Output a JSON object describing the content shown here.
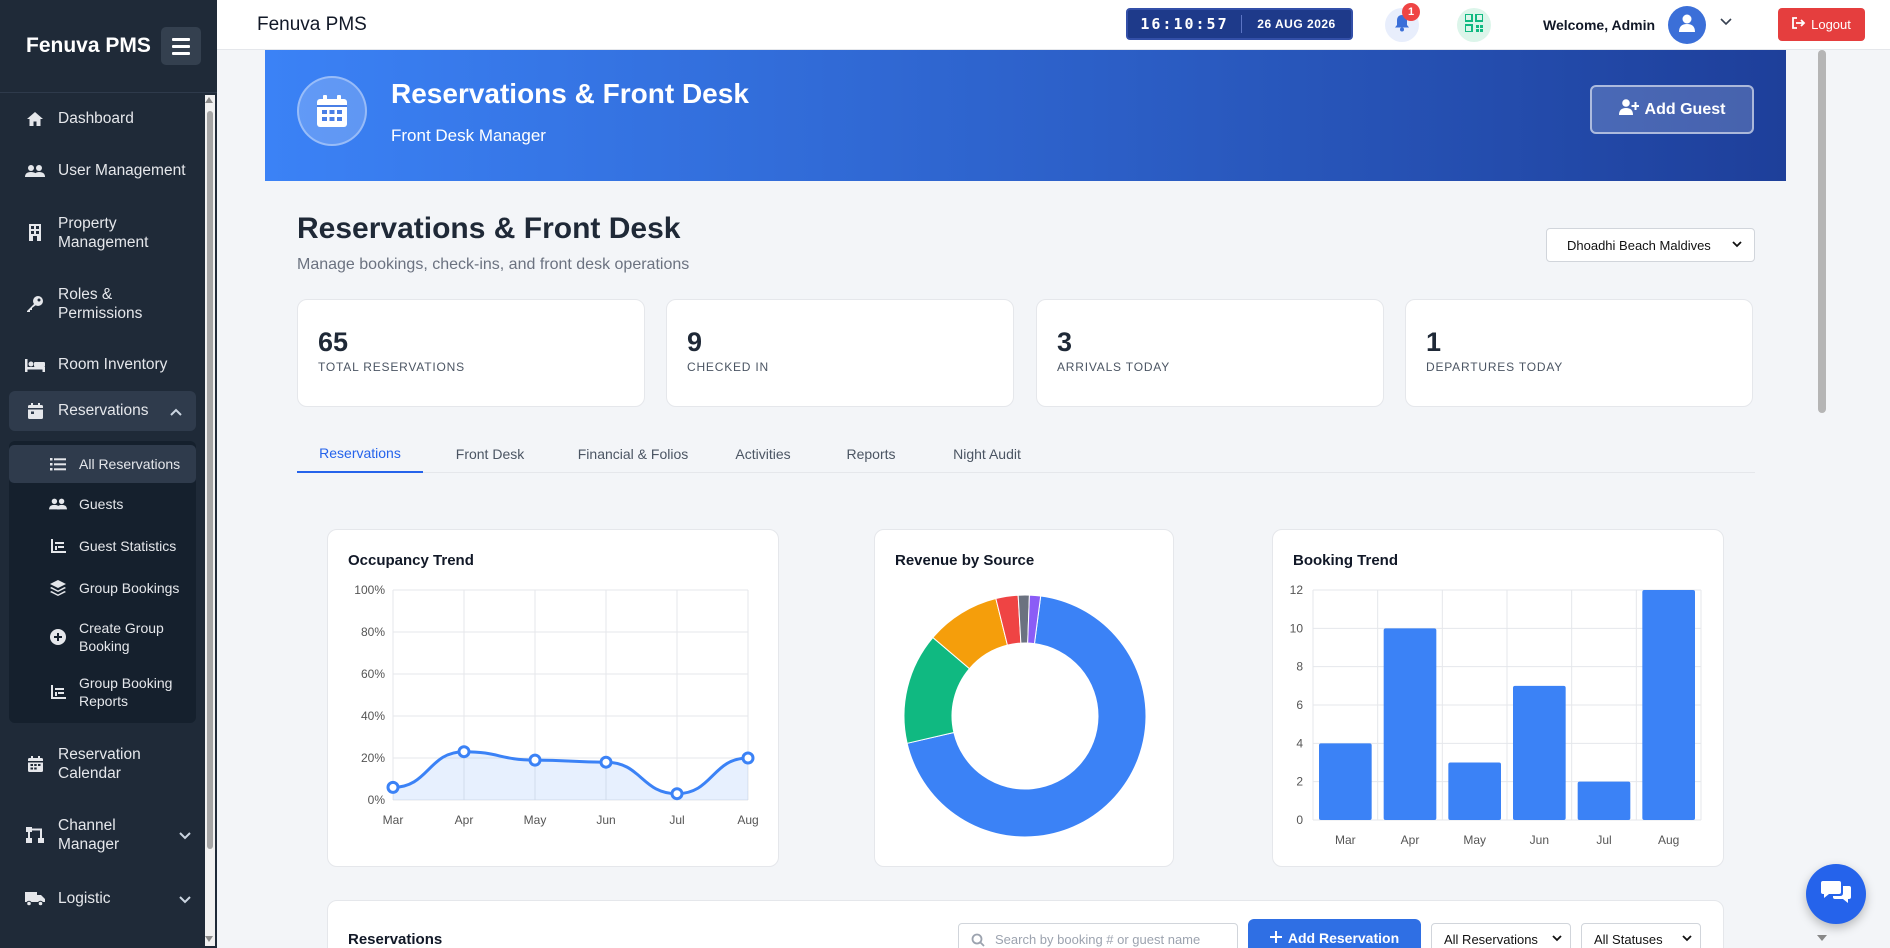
{
  "app": {
    "brand": "Fenuva PMS",
    "top_title": "Fenuva PMS"
  },
  "topbar": {
    "time": "16:10:57",
    "date": "26 AUG 2026",
    "notification_count": "1",
    "welcome": "Welcome, Admin",
    "logout_label": "Logout"
  },
  "sidebar": {
    "items": [
      {
        "label": "Dashboard",
        "icon": "home-icon"
      },
      {
        "label": "User Management",
        "icon": "users-icon"
      },
      {
        "label": "Property Management",
        "icon": "building-icon"
      },
      {
        "label": "Roles & Permissions",
        "icon": "key-icon"
      },
      {
        "label": "Room Inventory",
        "icon": "bed-icon"
      },
      {
        "label": "Reservations",
        "icon": "calendar-icon",
        "expanded": true
      },
      {
        "label": "Reservation Calendar",
        "icon": "calendar-icon"
      },
      {
        "label": "Channel Manager",
        "icon": "network-icon"
      },
      {
        "label": "Logistic",
        "icon": "truck-icon"
      }
    ],
    "subitems": [
      {
        "label": "All Reservations",
        "icon": "list-icon",
        "active": true
      },
      {
        "label": "Guests",
        "icon": "users-icon"
      },
      {
        "label": "Guest Statistics",
        "icon": "chart-icon"
      },
      {
        "label": "Group Bookings",
        "icon": "layers-icon"
      },
      {
        "label": "Create Group Booking",
        "icon": "plus-circle-icon"
      },
      {
        "label": "Group Booking Reports",
        "icon": "chart-icon"
      }
    ]
  },
  "banner": {
    "title": "Reservations & Front Desk",
    "subtitle": "Front Desk Manager",
    "add_guest_label": "Add Guest"
  },
  "page": {
    "title": "Reservations & Front Desk",
    "subtitle": "Manage bookings, check-ins, and front desk operations",
    "property_selected": "Dhoadhi Beach Maldives"
  },
  "stats": [
    {
      "value": "65",
      "label": "TOTAL RESERVATIONS"
    },
    {
      "value": "9",
      "label": "CHECKED IN"
    },
    {
      "value": "3",
      "label": "ARRIVALS TODAY"
    },
    {
      "value": "1",
      "label": "DEPARTURES TODAY"
    }
  ],
  "tabs": [
    {
      "label": "Reservations",
      "active": true
    },
    {
      "label": "Front Desk"
    },
    {
      "label": "Financial & Folios"
    },
    {
      "label": "Activities"
    },
    {
      "label": "Reports"
    },
    {
      "label": "Night Audit"
    }
  ],
  "colors": {
    "primary": "#3b82f6",
    "green": "#10b981",
    "orange": "#f59e0b",
    "red": "#ef4444",
    "gray": "#6b7280",
    "purple": "#8b5cf6",
    "danger": "#e53e3e"
  },
  "chart_data": [
    {
      "type": "line",
      "title": "Occupancy Trend",
      "categories": [
        "Mar",
        "Apr",
        "May",
        "Jun",
        "Jul",
        "Aug"
      ],
      "values": [
        6,
        23,
        19,
        18,
        3,
        20
      ],
      "yticks": [
        "0%",
        "20%",
        "40%",
        "60%",
        "80%",
        "100%"
      ],
      "ylim": [
        0,
        100
      ],
      "grid": true
    },
    {
      "type": "pie",
      "title": "Revenue by Source",
      "donut": true,
      "values": [
        70,
        15,
        10,
        3,
        1.5,
        1.5
      ],
      "colors": [
        "#3b82f6",
        "#10b981",
        "#f59e0b",
        "#ef4444",
        "#6b7280",
        "#8b5cf6"
      ]
    },
    {
      "type": "bar",
      "title": "Booking Trend",
      "categories": [
        "Mar",
        "Apr",
        "May",
        "Jun",
        "Jul",
        "Aug"
      ],
      "values": [
        4,
        10,
        3,
        7,
        2,
        12
      ],
      "yticks": [
        "0",
        "2",
        "4",
        "6",
        "8",
        "10",
        "12"
      ],
      "ylim": [
        0,
        12
      ],
      "grid": true
    }
  ],
  "reservations_section": {
    "title": "Reservations",
    "search_placeholder": "Search by booking # or guest name",
    "add_label": "Add Reservation",
    "filter1": "All Reservations",
    "filter2": "All Statuses"
  }
}
